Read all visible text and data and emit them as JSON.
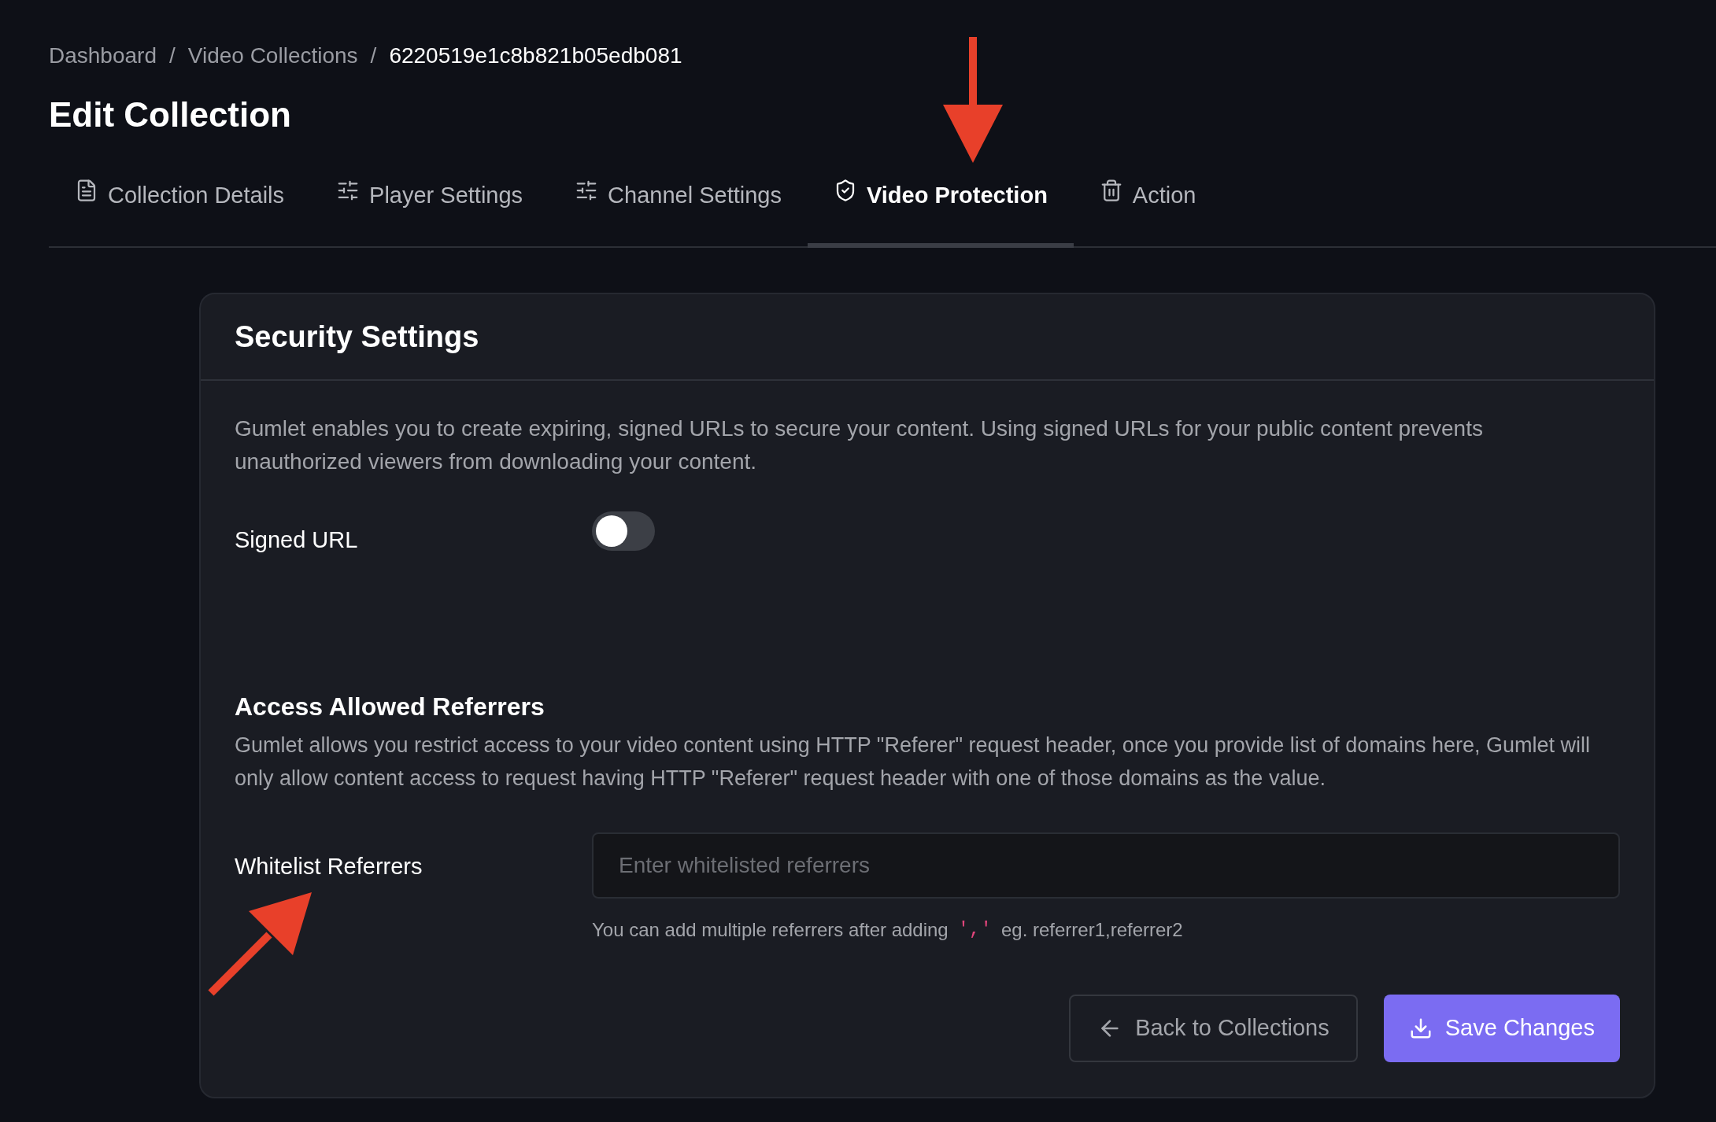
{
  "breadcrumbs": [
    {
      "label": "Dashboard",
      "current": false
    },
    {
      "label": "Video Collections",
      "current": false
    },
    {
      "label": "6220519e1c8b821b05edb081",
      "current": true
    }
  ],
  "breadcrumb_separator": "/",
  "title": "Edit Collection",
  "tabs": [
    {
      "label": "Collection Details",
      "kind": "details",
      "selected": false
    },
    {
      "label": "Player Settings",
      "kind": "sliders",
      "selected": false
    },
    {
      "label": "Channel Settings",
      "kind": "sliders",
      "selected": false
    },
    {
      "label": "Video Protection",
      "kind": "shield",
      "selected": true
    },
    {
      "label": "Action",
      "kind": "trash",
      "selected": false
    }
  ],
  "card": {
    "title": "Security Settings",
    "description": "Gumlet enables you to create expiring, signed URLs to secure your content. Using signed URLs for your public content prevents unauthorized viewers from downloading your content.",
    "signed_url": {
      "label": "Signed URL",
      "on": false
    },
    "referrers": {
      "heading": "Access Allowed Referrers",
      "description": "Gumlet allows you restrict access to your video content using HTTP \"Referer\" request header, once you provide list of domains here, Gumlet will only allow content access to request having HTTP \"Referer\" request header with one of those domains as the value.",
      "label": "Whitelist Referrers",
      "placeholder": "Enter whitelisted referrers",
      "hint_before": "You can add multiple referrers after adding",
      "hint_code": "','",
      "hint_after": "eg. referrer1,referrer2"
    },
    "buttons": [
      {
        "label": "Back to Collections",
        "kind": "secondary"
      },
      {
        "label": "Save Changes",
        "kind": "primary"
      }
    ]
  }
}
